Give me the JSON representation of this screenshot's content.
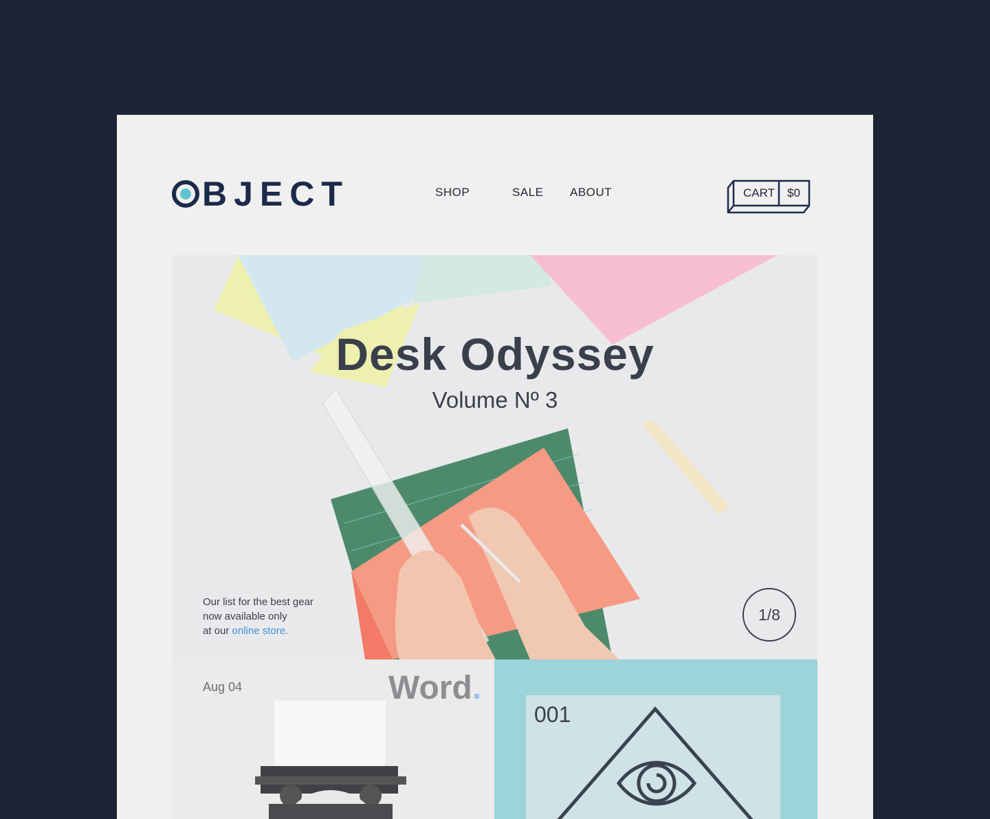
{
  "header": {
    "logo_text": "BJECT",
    "nav": [
      {
        "label": "SHOP"
      },
      {
        "label": "SALE"
      },
      {
        "label": "ABOUT"
      }
    ],
    "cart": {
      "label": "CART",
      "total": "$0"
    }
  },
  "hero": {
    "title": "Desk Odyssey",
    "subtitle": "Volume Nº  3",
    "note_line1": "Our list for the best gear",
    "note_line2": "now available only",
    "note_line3_prefix": "at our ",
    "note_link": "online store.",
    "counter": "1/8"
  },
  "cards": {
    "left": {
      "date": "Aug 04",
      "word": "Word",
      "word_dot": "."
    },
    "right": {
      "number": "001"
    }
  },
  "colors": {
    "background": "#1c2335",
    "page": "#f0f0f0",
    "brand_navy": "#1c2a4a",
    "accent_teal": "#5fc4cf",
    "link_blue": "#3d8fd6"
  }
}
